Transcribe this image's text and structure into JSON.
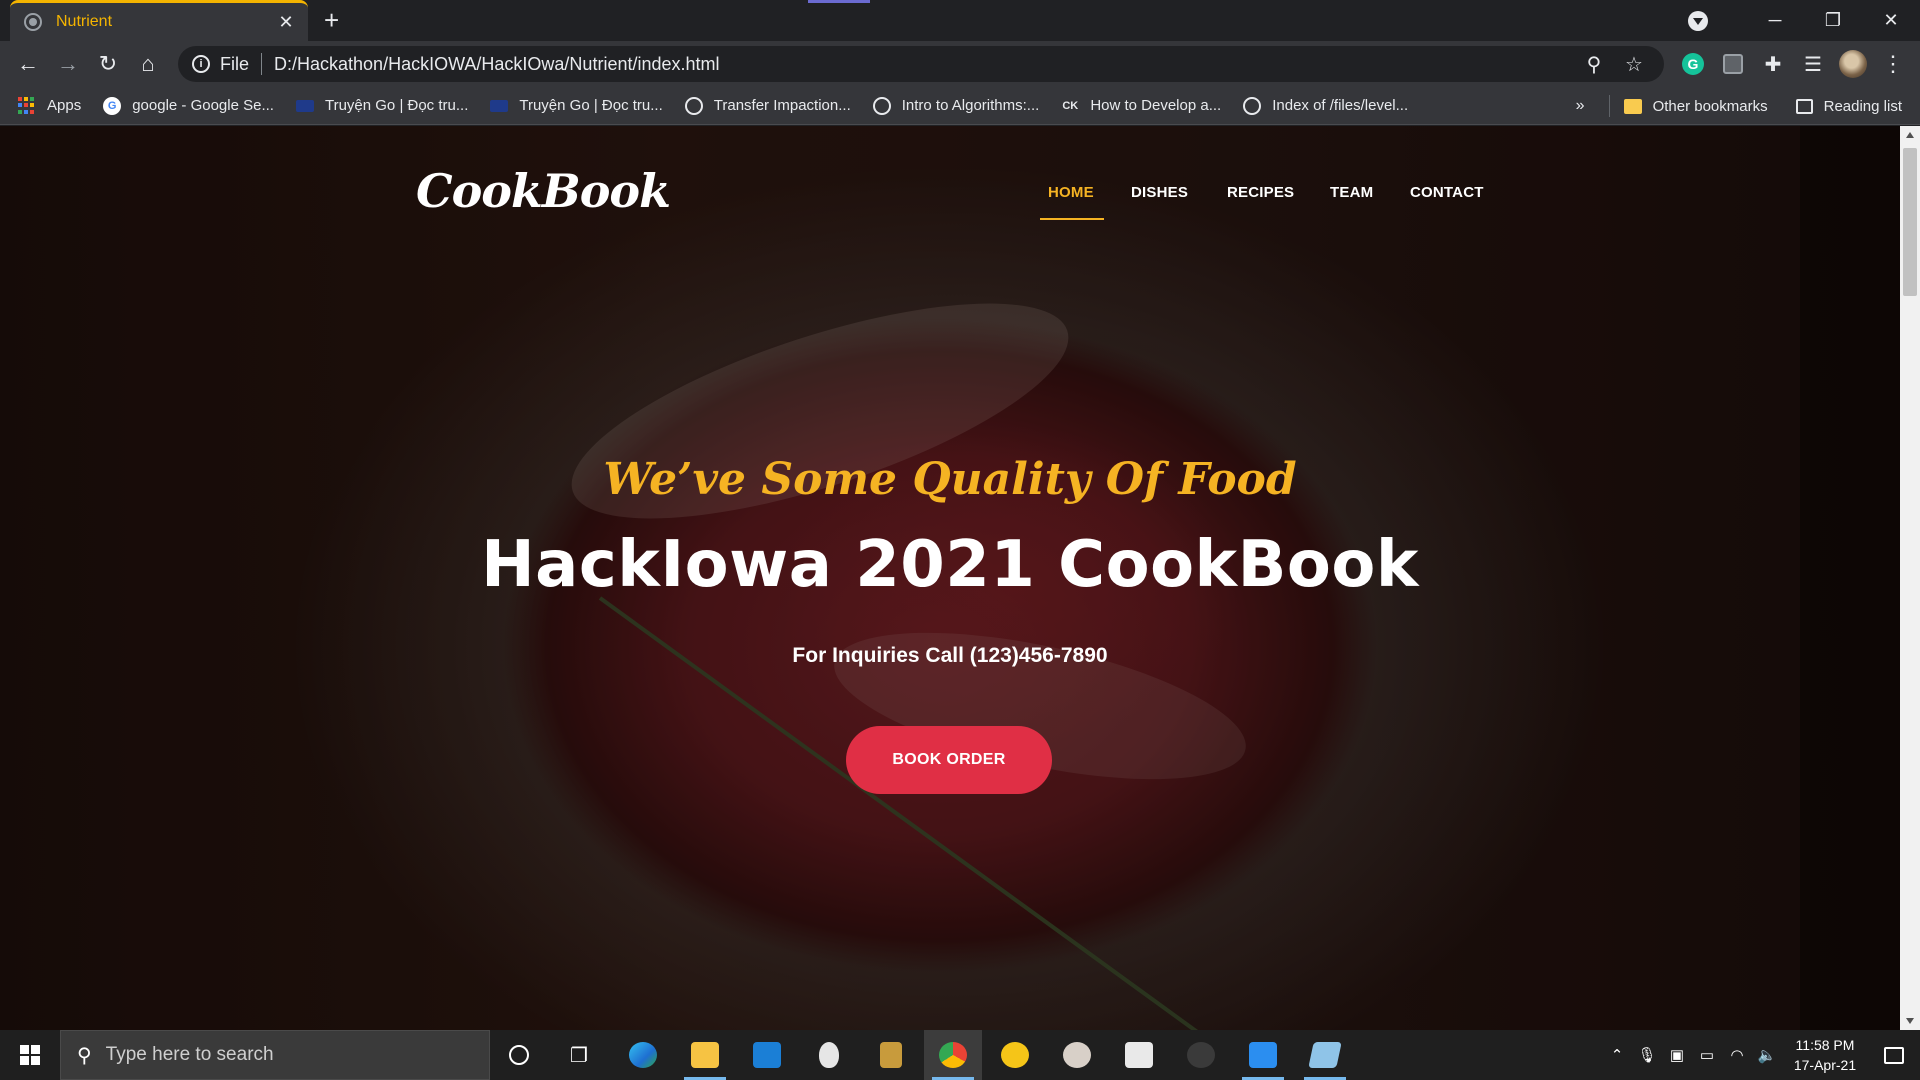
{
  "browser": {
    "tab_title": "Nutrient",
    "tab_close": "✕",
    "new_tab": "+",
    "scheme_label": "File",
    "url": "D:/Hackathon/HackIOWA/HackIOwa/Nutrient/index.html",
    "window_controls": {
      "minimize": "─",
      "restore": "❐",
      "close": "✕"
    },
    "nav": {
      "back": "←",
      "forward": "→",
      "reload": "↻",
      "home": "⌂"
    },
    "omni_icons": {
      "zoom": "⚲",
      "star": "☆"
    },
    "ext_grammarly": "G",
    "toolbar_icons": {
      "puzzle": "✚",
      "playlist": "☰",
      "menu": "⋮"
    }
  },
  "bookmarks": {
    "items": [
      {
        "label": "Apps",
        "icon": "apps-grid"
      },
      {
        "label": "google - Google Se...",
        "icon": "google-icon"
      },
      {
        "label": "Truyện Go | Đọc tru...",
        "icon": "book-icon"
      },
      {
        "label": "Truyện Go | Đọc tru...",
        "icon": "book-icon"
      },
      {
        "label": "Transfer Impaction...",
        "icon": "globe-icon"
      },
      {
        "label": "Intro to Algorithms:...",
        "icon": "globe-icon"
      },
      {
        "label": "How to Develop a...",
        "icon": "ck-icon"
      },
      {
        "label": "Index of /files/level...",
        "icon": "globe-icon"
      }
    ],
    "overflow": "»",
    "other_bookmarks": "Other bookmarks",
    "reading_list": "Reading list"
  },
  "site": {
    "logo": "CookBook",
    "nav": [
      {
        "label": "HOME",
        "active": true
      },
      {
        "label": "DISHES",
        "active": false
      },
      {
        "label": "RECIPES",
        "active": false
      },
      {
        "label": "TEAM",
        "active": false
      },
      {
        "label": "CONTACT",
        "active": false
      }
    ],
    "tagline": "We’ve Some Quality Of Food",
    "headline": "HackIowa 2021 CookBook",
    "inquiry": "For Inquiries Call (123)456-7890",
    "cta": "BOOK ORDER",
    "colors": {
      "accent": "#f5b323",
      "button": "#e02f45"
    }
  },
  "taskbar": {
    "search_placeholder": "Type here to search",
    "apps": [
      "cortana",
      "task-view",
      "edge",
      "file-explorer",
      "mail",
      "alienware",
      "league",
      "chrome",
      "wps",
      "game",
      "app-grid",
      "shield",
      "vscode",
      "notes"
    ],
    "time": "11:58 PM",
    "date": "17-Apr-21"
  }
}
